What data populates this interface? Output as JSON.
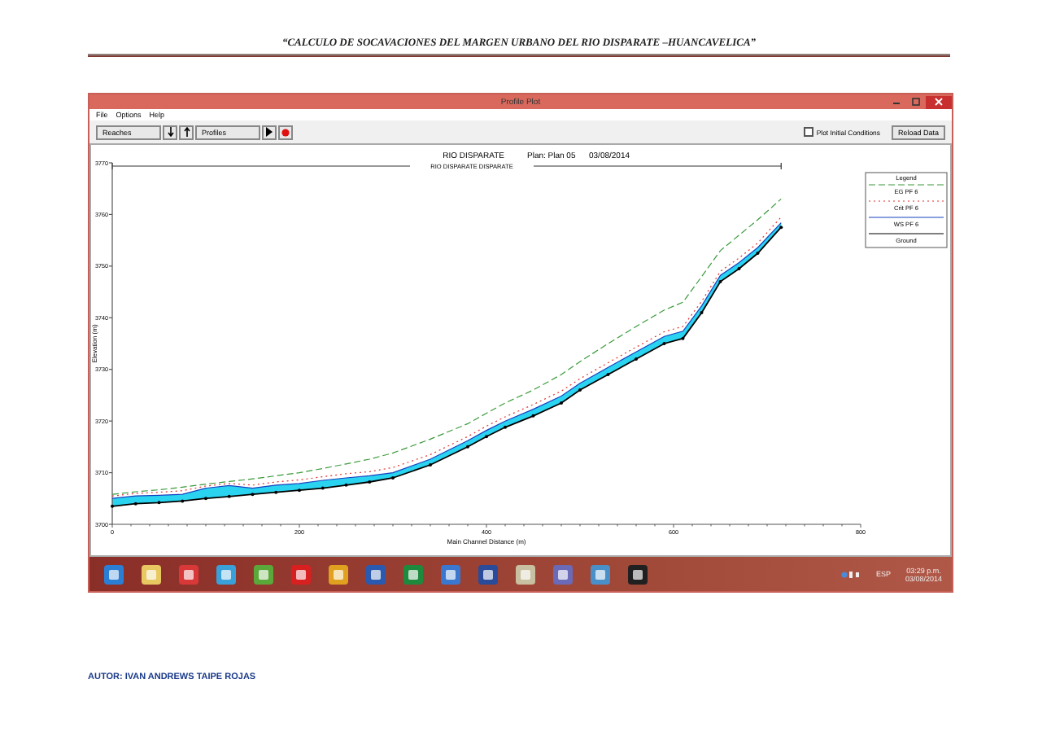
{
  "document": {
    "header": "“CALCULO DE SOCAVACIONES DEL MARGEN URBANO DEL RIO DISPARATE –HUANCAVELICA”",
    "footer": "AUTOR: IVAN ANDREWS TAIPE ROJAS"
  },
  "window": {
    "title": "Profile Plot"
  },
  "menu": [
    "File",
    "Options",
    "Help"
  ],
  "toolbar": {
    "reaches_button": "Reaches",
    "profiles_button": "Profiles",
    "initial_conditions": {
      "label": "Plot Initial Conditions",
      "checked": false
    },
    "reload_button": "Reload Data"
  },
  "plot": {
    "river": "RIO DISPARATE",
    "plan": "Plan: Plan 05",
    "date": "03/08/2014",
    "reach": "RIO DISPARATE DISPARATE",
    "legend_title": "Legend",
    "chart_data": {
      "type": "line",
      "xlabel": "Main Channel Distance (m)",
      "ylabel": "Elevation (m)",
      "xlim": [
        0,
        800
      ],
      "ylim": [
        3700,
        3770
      ],
      "xticks": [
        0,
        200,
        400,
        600,
        800
      ],
      "yticks": [
        3700,
        3710,
        3720,
        3730,
        3740,
        3750,
        3760,
        3770
      ],
      "x": [
        0,
        25,
        50,
        75,
        100,
        125,
        150,
        175,
        200,
        225,
        250,
        275,
        300,
        340,
        380,
        400,
        420,
        450,
        480,
        500,
        530,
        560,
        590,
        610,
        630,
        650,
        670,
        690,
        715
      ],
      "series": [
        {
          "name": "EG PF 6",
          "color": "#3a9a3a",
          "line_style": "dashed",
          "values": [
            3705.8,
            3706.3,
            3706.7,
            3707.2,
            3707.8,
            3708.3,
            3708.8,
            3709.4,
            3710,
            3710.8,
            3711.7,
            3712.6,
            3713.8,
            3716.5,
            3719.5,
            3721.5,
            3723.5,
            3726,
            3729,
            3731.5,
            3735,
            3738.3,
            3741.5,
            3743,
            3748,
            3753,
            3756,
            3759,
            3763
          ]
        },
        {
          "name": "Crit PF 6",
          "color": "#e03030",
          "line_style": "dotted",
          "values": [
            3705.5,
            3706,
            3706.2,
            3706.5,
            3707.4,
            3707.9,
            3707.6,
            3708.2,
            3708.6,
            3709.2,
            3709.8,
            3710.2,
            3711,
            3713.5,
            3717,
            3719,
            3720.8,
            3723.2,
            3725.8,
            3728.2,
            3731.3,
            3734.3,
            3737.3,
            3738.3,
            3743.2,
            3749,
            3751.6,
            3754.5,
            3759.5
          ]
        },
        {
          "name": "WS PF 6",
          "color": "#1840c0",
          "line_style": "solid",
          "values": [
            3705,
            3705.5,
            3705.6,
            3705.8,
            3707,
            3707.5,
            3707,
            3707.6,
            3707.9,
            3708.5,
            3709,
            3709.4,
            3710,
            3712.6,
            3716.2,
            3718.2,
            3720,
            3722.3,
            3724.8,
            3727.3,
            3730.4,
            3733.4,
            3736.4,
            3737.4,
            3742.3,
            3748.2,
            3750.7,
            3753.6,
            3758.4
          ]
        },
        {
          "name": "Ground",
          "color": "#000000",
          "line_style": "solid",
          "values": [
            3703.5,
            3704,
            3704.2,
            3704.5,
            3705,
            3705.4,
            3705.8,
            3706.2,
            3706.6,
            3707,
            3707.6,
            3708.2,
            3709,
            3711.5,
            3715,
            3717,
            3718.8,
            3721,
            3723.5,
            3726,
            3729,
            3732,
            3735,
            3736,
            3741,
            3747,
            3749.5,
            3752.5,
            3757.5
          ]
        }
      ]
    }
  },
  "taskbar": {
    "language": "ESP",
    "time": "03:29 p.m.",
    "date": "03/08/2014"
  }
}
